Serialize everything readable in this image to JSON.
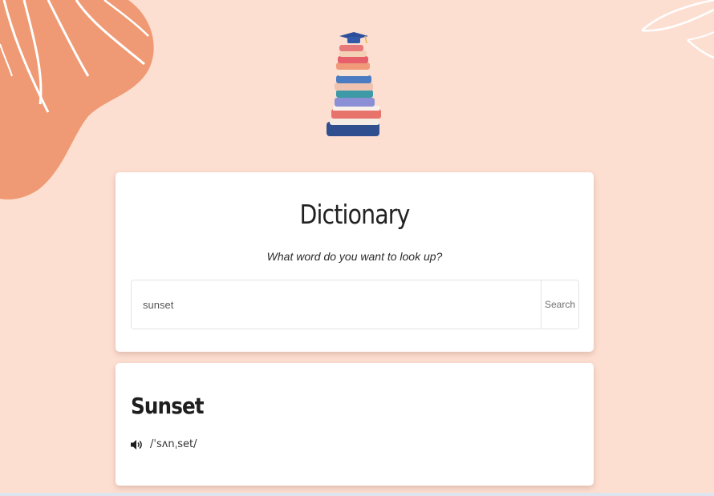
{
  "app": {
    "title": "Dictionary",
    "subtitle": "What word do you want to look up?"
  },
  "search": {
    "value": "sunset",
    "button_label": "Search"
  },
  "result": {
    "word": "Sunset",
    "phonetic": "/ˈsʌnˌset/",
    "audio_icon": "speaker-icon"
  },
  "colors": {
    "background": "#fddfd2",
    "accent": "#ef9a74",
    "card": "#ffffff"
  }
}
